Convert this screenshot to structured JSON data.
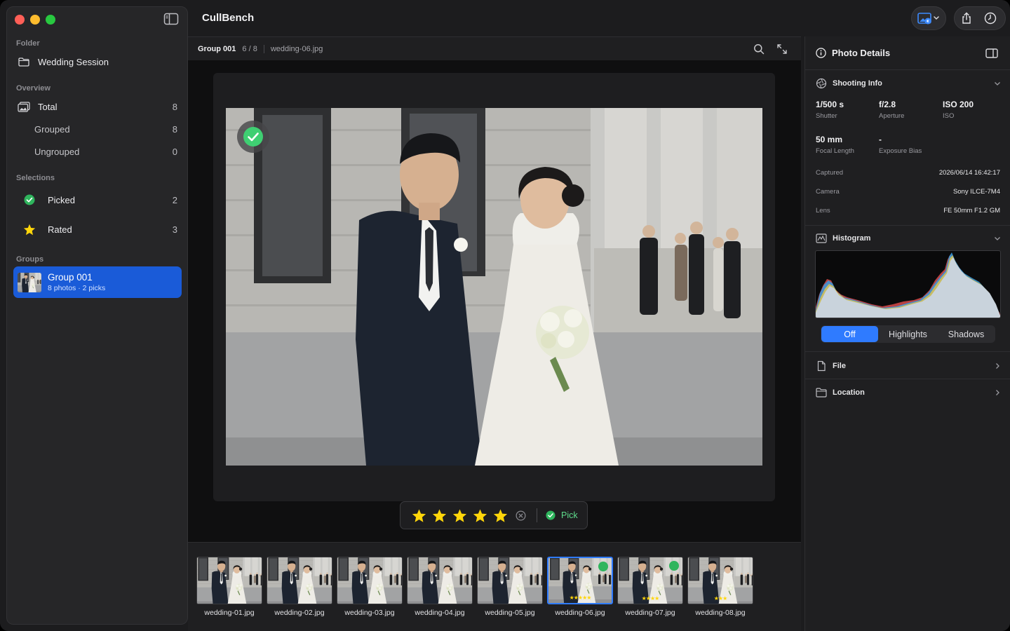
{
  "app": {
    "title": "CullBench"
  },
  "sidebar": {
    "folder_header": "Folder",
    "folder_name": "Wedding Session",
    "overview_header": "Overview",
    "overview": [
      {
        "label": "Total",
        "count": "8"
      },
      {
        "label": "Grouped",
        "count": "8"
      },
      {
        "label": "Ungrouped",
        "count": "0"
      }
    ],
    "selections_header": "Selections",
    "selections": [
      {
        "label": "Picked",
        "count": "2"
      },
      {
        "label": "Rated",
        "count": "3"
      }
    ],
    "groups_header": "Groups",
    "group": {
      "title": "Group 001",
      "subtitle": "8 photos · 2 picks"
    }
  },
  "viewer": {
    "group": "Group 001",
    "counter": "6 / 8",
    "filename": "wedding-06.jpg",
    "rating": 5,
    "pick_label": "Pick",
    "picked": true
  },
  "filmstrip": [
    {
      "name": "wedding-01.jpg",
      "picked": false,
      "stars": ""
    },
    {
      "name": "wedding-02.jpg",
      "picked": false,
      "stars": ""
    },
    {
      "name": "wedding-03.jpg",
      "picked": false,
      "stars": ""
    },
    {
      "name": "wedding-04.jpg",
      "picked": false,
      "stars": ""
    },
    {
      "name": "wedding-05.jpg",
      "picked": false,
      "stars": ""
    },
    {
      "name": "wedding-06.jpg",
      "picked": true,
      "stars": "★★★★★",
      "selected": true
    },
    {
      "name": "wedding-07.jpg",
      "picked": true,
      "stars": "★★★★"
    },
    {
      "name": "wedding-08.jpg",
      "picked": false,
      "stars": "★★★"
    }
  ],
  "details": {
    "title": "Photo Details",
    "shooting_title": "Shooting Info",
    "shutter": {
      "value": "1/500 s",
      "label": "Shutter"
    },
    "aperture": {
      "value": "f/2.8",
      "label": "Aperture"
    },
    "iso": {
      "value": "ISO 200",
      "label": "ISO"
    },
    "focal": {
      "value": "50 mm",
      "label": "Focal Length"
    },
    "bias": {
      "value": "-",
      "label": "Exposure Bias"
    },
    "captured": {
      "label": "Captured",
      "value": "2026/06/14 16:42:17"
    },
    "camera": {
      "label": "Camera",
      "value": "Sony ILCE-7M4"
    },
    "lens": {
      "label": "Lens",
      "value": "FE 50mm F1.2 GM"
    },
    "histogram_title": "Histogram",
    "histogram_modes": [
      "Off",
      "Highlights",
      "Shadows"
    ],
    "histogram_active": "Off",
    "file_title": "File",
    "location_title": "Location"
  },
  "colors": {
    "accent": "#2f7bff",
    "pick": "#2fb55d",
    "star": "#ffd60a",
    "selection": "#1a5bd8"
  }
}
